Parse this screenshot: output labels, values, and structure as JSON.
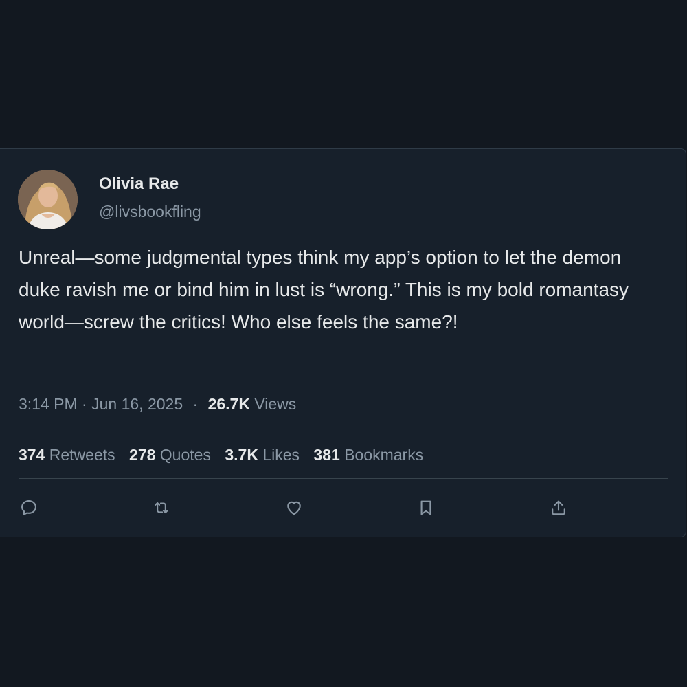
{
  "tweet": {
    "author": {
      "display_name": "Olivia Rae",
      "handle": "@livsbookfling"
    },
    "text": "Unreal—some judgmental types think my app’s option to let the demon duke ravish me or bind him in lust is “wrong.” This is my bold romantasy world—screw the critics! Who else feels the same?!",
    "time": "3:14 PM",
    "date": "Jun 16, 2025",
    "separator": "·",
    "views": {
      "count": "26.7K",
      "label": "Views"
    },
    "stats": {
      "retweets": {
        "count": "374",
        "label": "Retweets"
      },
      "quotes": {
        "count": "278",
        "label": "Quotes"
      },
      "likes": {
        "count": "3.7K",
        "label": "Likes"
      },
      "bookmarks": {
        "count": "381",
        "label": "Bookmarks"
      }
    },
    "actions": [
      "reply-icon",
      "retweet-icon",
      "like-icon",
      "bookmark-icon",
      "share-icon"
    ]
  },
  "colors": {
    "background": "#121820",
    "card": "#17202b",
    "text_primary": "#e7e9ea",
    "text_secondary": "#8b98a5",
    "divider": "#38444d"
  }
}
